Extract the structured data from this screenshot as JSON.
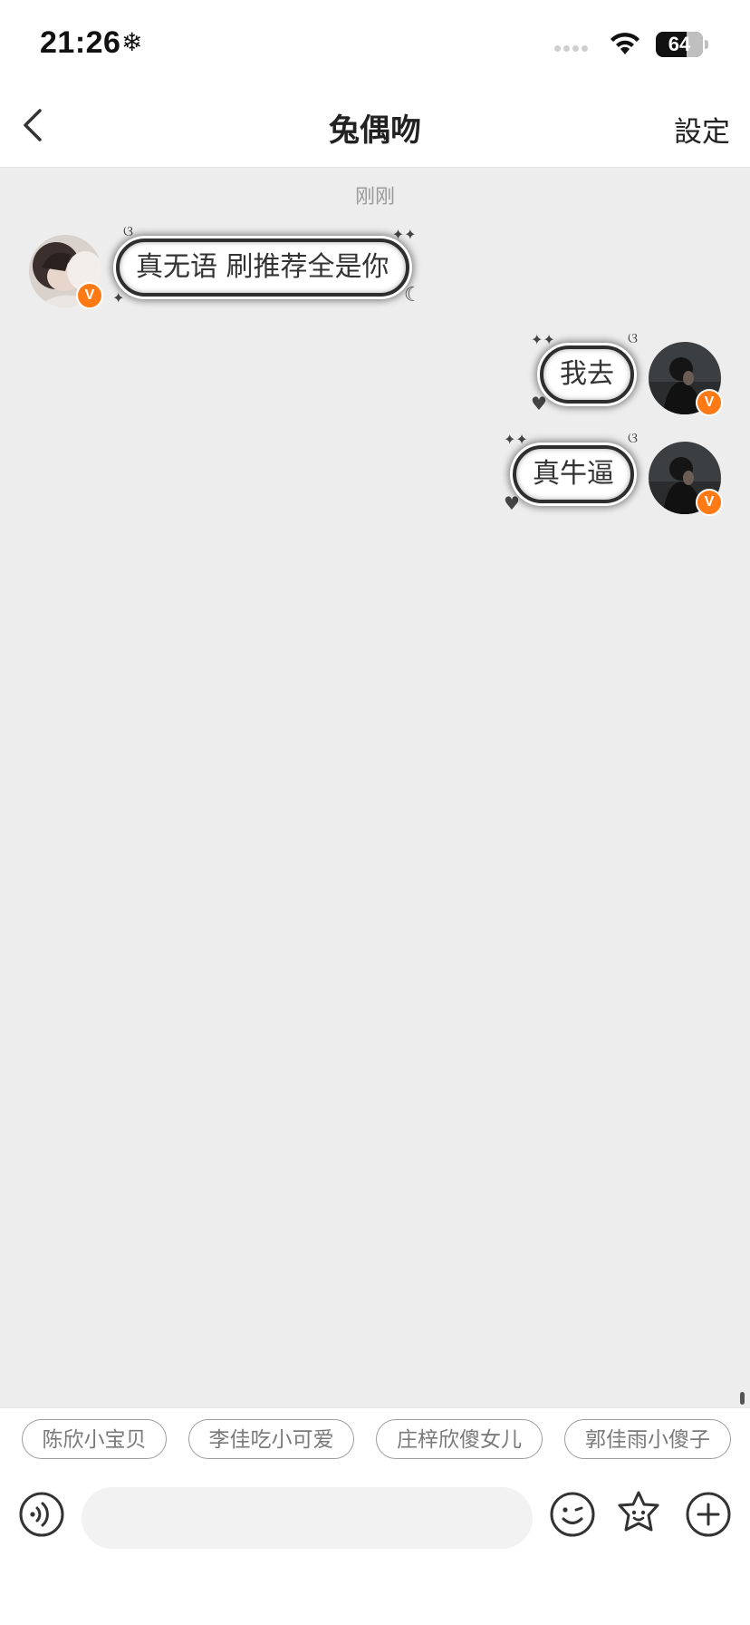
{
  "status_bar": {
    "time": "21:26",
    "extra_icon": "❄",
    "battery": "64"
  },
  "nav": {
    "back_icon": "chevron-left-icon",
    "title": "兔偶吻",
    "settings_label": "設定"
  },
  "chat": {
    "timestamp": "刚刚",
    "messages": [
      {
        "side": "left",
        "text": "真无语 刷推荐全是你",
        "badge": "V"
      },
      {
        "side": "right",
        "text": "我去",
        "badge": "V"
      },
      {
        "side": "right",
        "text": "真牛逼",
        "badge": "V"
      }
    ]
  },
  "quick_replies": [
    "陈欣小宝贝",
    "李佳吃小可爱",
    "庄梓欣傻女儿",
    "郭佳雨小傻子"
  ],
  "input_bar": {
    "placeholder": "",
    "icons": [
      "voice-icon",
      "emoji-icon",
      "sticker-icon",
      "plus-icon"
    ]
  },
  "colors": {
    "chat_background": "#ededed",
    "verified_badge": "#ff7a14",
    "bubble_border": "#2e2e2e"
  }
}
